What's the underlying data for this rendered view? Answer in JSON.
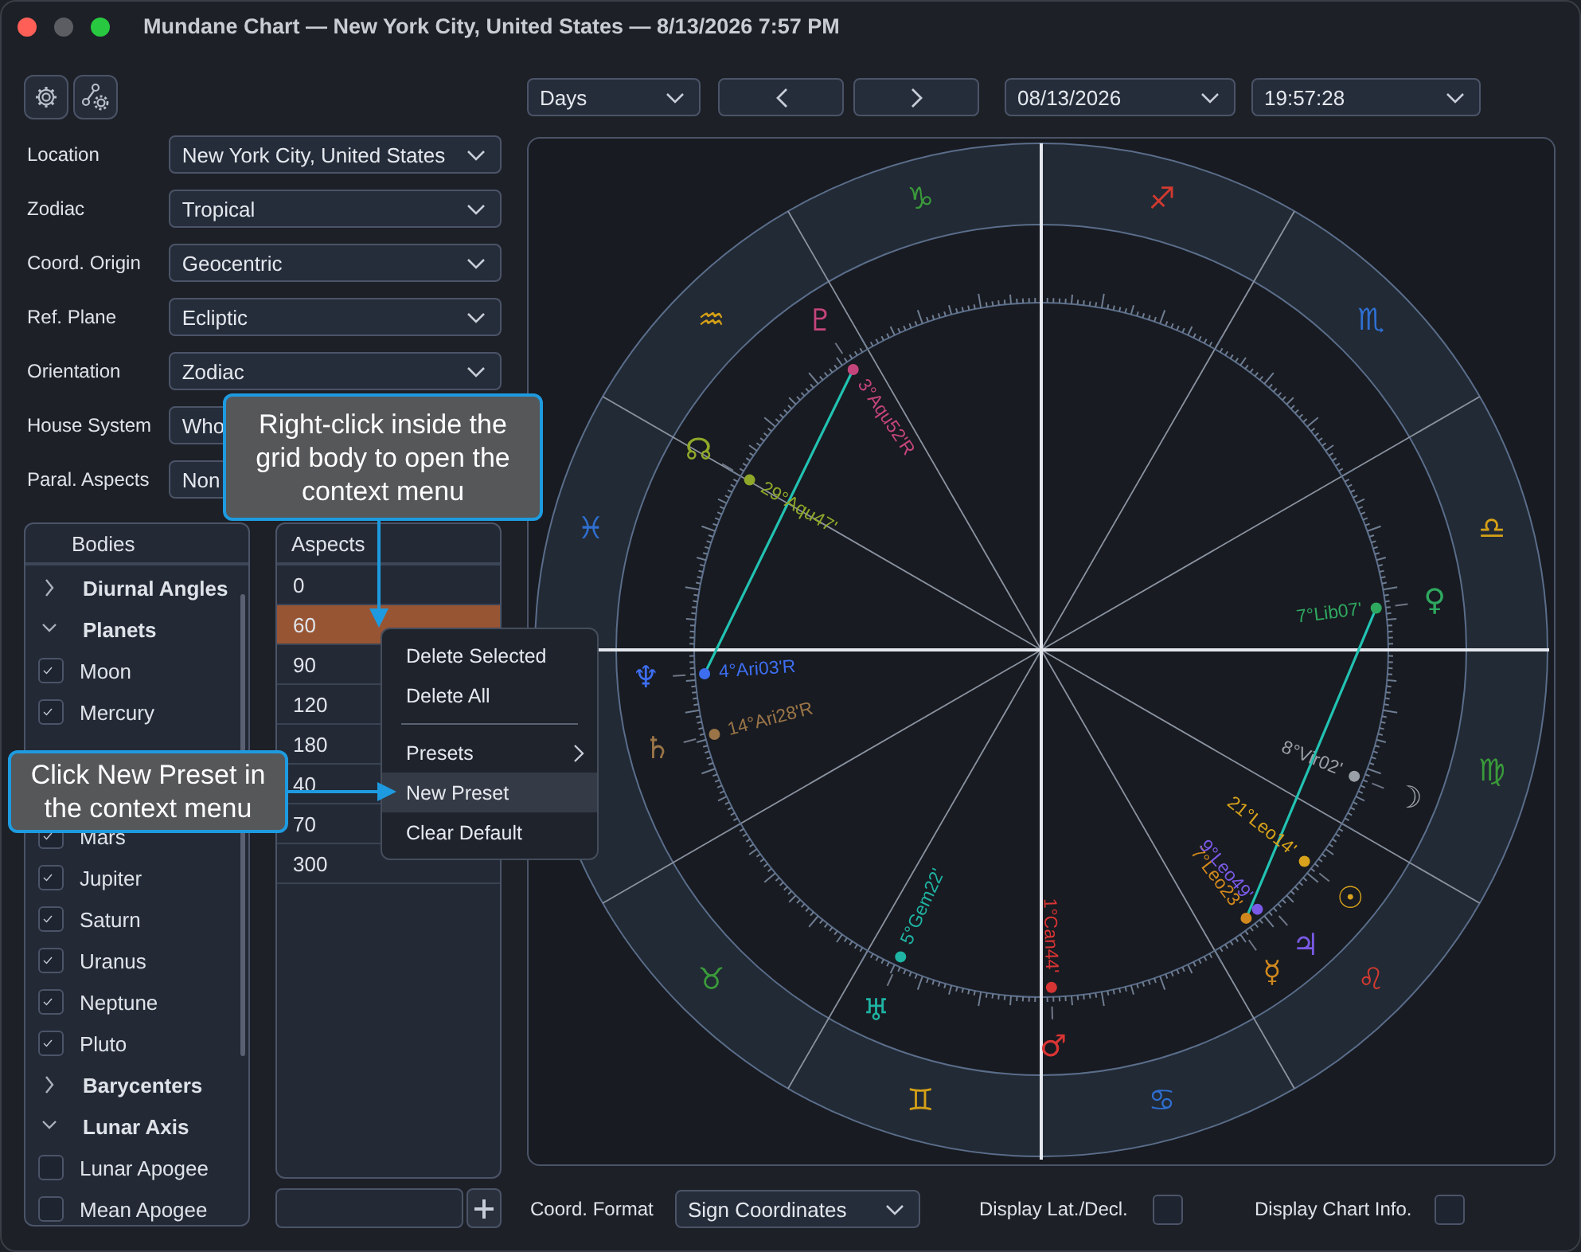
{
  "window": {
    "title": "Mundane Chart — New York City, United States — 8/13/2026 7:57 PM"
  },
  "settings": [
    {
      "label": "Location",
      "value": "New York City, United States"
    },
    {
      "label": "Zodiac",
      "value": "Tropical"
    },
    {
      "label": "Coord. Origin",
      "value": "Geocentric"
    },
    {
      "label": "Ref. Plane",
      "value": "Ecliptic"
    },
    {
      "label": "Orientation",
      "value": "Zodiac"
    },
    {
      "label": "House System",
      "value": "Who"
    },
    {
      "label": "Paral. Aspects",
      "value": "Non"
    }
  ],
  "bodies": {
    "title": "Bodies",
    "items": [
      {
        "kind": "group",
        "label": "Diurnal Angles",
        "expanded": false
      },
      {
        "kind": "group",
        "label": "Planets",
        "expanded": true
      },
      {
        "kind": "check",
        "label": "Moon",
        "checked": true
      },
      {
        "kind": "check",
        "label": "Mercury",
        "checked": true
      },
      {
        "kind": "check",
        "label": "Mars",
        "checked": true
      },
      {
        "kind": "check",
        "label": "Jupiter",
        "checked": true
      },
      {
        "kind": "check",
        "label": "Saturn",
        "checked": true
      },
      {
        "kind": "check",
        "label": "Uranus",
        "checked": true
      },
      {
        "kind": "check",
        "label": "Neptune",
        "checked": true
      },
      {
        "kind": "check",
        "label": "Pluto",
        "checked": true
      },
      {
        "kind": "group",
        "label": "Barycenters",
        "expanded": false
      },
      {
        "kind": "group",
        "label": "Lunar Axis",
        "expanded": true
      },
      {
        "kind": "check",
        "label": "Lunar Apogee",
        "checked": false
      },
      {
        "kind": "check",
        "label": "Mean Apogee",
        "checked": false
      }
    ]
  },
  "aspects": {
    "title": "Aspects",
    "rows": [
      {
        "value": "0",
        "selected": false
      },
      {
        "value": "60",
        "selected": true
      },
      {
        "value": "90",
        "selected": false
      },
      {
        "value": "120",
        "selected": false
      },
      {
        "value": "180",
        "selected": false
      },
      {
        "value": "40",
        "selected": false
      },
      {
        "value": "70",
        "selected": false
      },
      {
        "value": "300",
        "selected": false
      }
    ]
  },
  "context_menu": [
    {
      "kind": "item",
      "label": "Delete Selected",
      "highlighted": false
    },
    {
      "kind": "item",
      "label": "Delete All",
      "highlighted": false
    },
    {
      "kind": "separator"
    },
    {
      "kind": "submenu",
      "label": "Presets",
      "highlighted": false
    },
    {
      "kind": "item",
      "label": "New Preset",
      "highlighted": true
    },
    {
      "kind": "item",
      "label": "Clear Default",
      "highlighted": false
    }
  ],
  "callouts": [
    {
      "text": "Right-click inside the grid body to open the context menu"
    },
    {
      "text": "Click New Preset in the context menu"
    }
  ],
  "top_bar": {
    "period": "Days",
    "date": "08/13/2026",
    "time": "19:57:28"
  },
  "chart": {
    "signs": [
      {
        "glyph": "♉",
        "color": "#3a9a3a"
      },
      {
        "glyph": "♊",
        "color": "#d4a017"
      },
      {
        "glyph": "♋",
        "color": "#2f6fd0"
      },
      {
        "glyph": "♌",
        "color": "#d23a30"
      },
      {
        "glyph": "♍",
        "color": "#3a9a3a"
      },
      {
        "glyph": "♎",
        "color": "#d4a017"
      },
      {
        "glyph": "♏",
        "color": "#2f6fd0"
      },
      {
        "glyph": "♐",
        "color": "#d23a30"
      },
      {
        "glyph": "♑",
        "color": "#3a9a3a"
      },
      {
        "glyph": "♒",
        "color": "#d4a017"
      },
      {
        "glyph": "♓",
        "color": "#2f6fd0"
      }
    ],
    "planets": [
      {
        "glyph": "♇",
        "label": "3°Aqu52'R",
        "color": "#c4457c"
      },
      {
        "glyph": "☊",
        "label": "29°Aqu47'",
        "color": "#8fa82a"
      },
      {
        "glyph": "♆",
        "label": "4°Ari03'R",
        "color": "#3d6ef0"
      },
      {
        "glyph": "♄",
        "label": "14°Ari28'R",
        "color": "#9a7548"
      },
      {
        "glyph": "♅",
        "label": "5°Gem22'",
        "color": "#1fb3a3"
      },
      {
        "glyph": "♂",
        "label": "1°Can44'",
        "color": "#d83434"
      },
      {
        "glyph": "☿",
        "label": "7°Leo23'",
        "color": "#d0881e"
      },
      {
        "glyph": "♃",
        "label": "9°Leo49'",
        "color": "#7a5ae6"
      },
      {
        "glyph": "☉",
        "label": "21°Leo14'",
        "color": "#d8a21c"
      },
      {
        "glyph": "☽",
        "label": "8°Vir02'",
        "color": "#9aa0a8"
      },
      {
        "glyph": "♀",
        "label": "7°Lib07'",
        "color": "#2fa860"
      }
    ]
  },
  "bottom_bar": {
    "format_label": "Coord. Format",
    "format_value": "Sign Coordinates",
    "options": [
      {
        "label": "Display Lat./Decl.",
        "checked": false
      },
      {
        "label": "Display Chart Info.",
        "checked": false
      }
    ]
  }
}
